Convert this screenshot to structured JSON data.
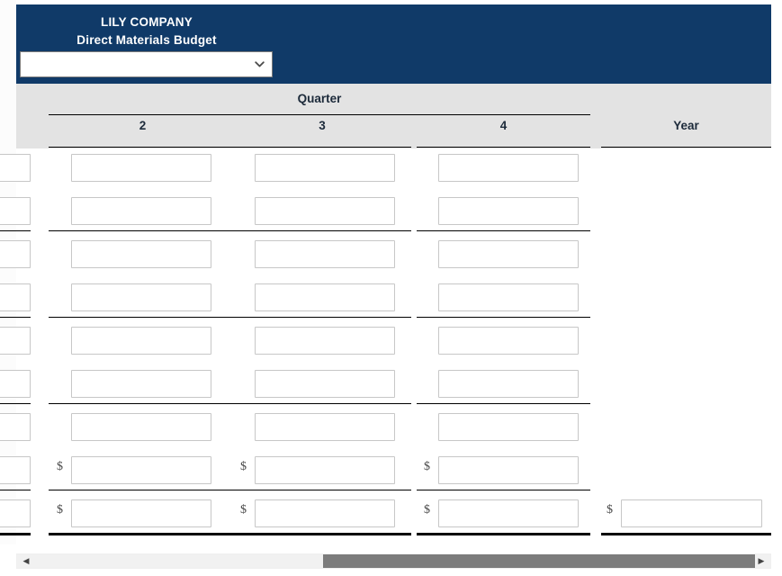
{
  "document": {
    "company": "LILY COMPANY",
    "report_title": "Direct Materials Budget",
    "period_select": {
      "value": "",
      "placeholder": "",
      "options": [
        ""
      ],
      "icon": "chevron-down-icon"
    }
  },
  "table": {
    "group_header": "Quarter",
    "columns": [
      {
        "key": "q2",
        "label": "2",
        "kind": "quarter"
      },
      {
        "key": "q3",
        "label": "3",
        "kind": "quarter"
      },
      {
        "key": "q4",
        "label": "4",
        "kind": "quarter"
      },
      {
        "key": "year",
        "label": "Year",
        "kind": "year"
      }
    ],
    "rows": [
      {
        "id": "row-1",
        "q2": "",
        "q3": "",
        "q4": "",
        "year": "",
        "currency": false,
        "year_input": false
      },
      {
        "id": "row-2",
        "q2": "",
        "q3": "",
        "q4": "",
        "year": "",
        "currency": false,
        "year_input": false
      },
      {
        "id": "row-3",
        "q2": "",
        "q3": "",
        "q4": "",
        "year": "",
        "currency": false,
        "year_input": false
      },
      {
        "id": "row-4",
        "q2": "",
        "q3": "",
        "q4": "",
        "year": "",
        "currency": false,
        "year_input": false
      },
      {
        "id": "row-5",
        "q2": "",
        "q3": "",
        "q4": "",
        "year": "",
        "currency": false,
        "year_input": false
      },
      {
        "id": "row-6",
        "q2": "",
        "q3": "",
        "q4": "",
        "year": "",
        "currency": false,
        "year_input": false
      },
      {
        "id": "row-7",
        "q2": "",
        "q3": "",
        "q4": "",
        "year": "",
        "currency": false,
        "year_input": false
      },
      {
        "id": "row-8",
        "q2": "",
        "q3": "",
        "q4": "",
        "year": "",
        "currency": true,
        "year_input": false
      },
      {
        "id": "row-9",
        "q2": "",
        "q3": "",
        "q4": "",
        "year": "",
        "currency": true,
        "year_input": true
      }
    ],
    "currency_symbol": "$",
    "separator_after_rows": [
      2,
      4,
      6,
      8
    ],
    "bottom_rule_after_row": 9
  },
  "scrollbar": {
    "left_arrow": "◀",
    "right_arrow": "▶",
    "orientation": "horizontal"
  },
  "colors": {
    "banner": "#103a68",
    "header_band": "#e3e3e3",
    "rule": "#000000",
    "input_border": "#c7c7c7",
    "scroll_thumb": "#7c7c7c",
    "scroll_track": "#f1f1f1",
    "banner_text": "#ffffff",
    "header_text": "#1c2a3a"
  }
}
